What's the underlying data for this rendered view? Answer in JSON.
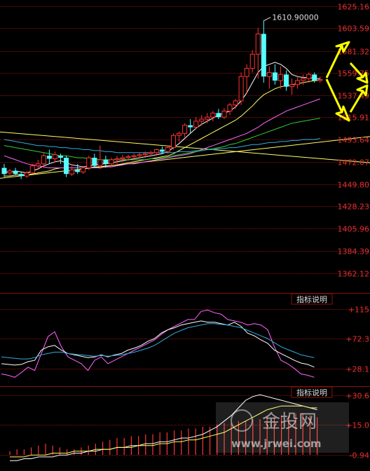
{
  "chart_data": [
    {
      "type": "candlestick",
      "price_axis": {
        "ticks": [
          "1625.16",
          "1603.59",
          "1581.32",
          "1559.75",
          "1537.49",
          "1515.91",
          "1493.64",
          "1472.07",
          "1449.80",
          "1428.23",
          "1405.96",
          "1384.39",
          "1362.12"
        ],
        "tick_values": [
          1625.16,
          1603.59,
          1581.32,
          1559.75,
          1537.49,
          1515.91,
          1493.64,
          1472.07,
          1449.8,
          1428.23,
          1405.96,
          1384.39,
          1362.12
        ],
        "ylim": [
          1345,
          1627
        ]
      },
      "annotation": {
        "label": "1610.90000",
        "value": 1610.9,
        "index": 46
      },
      "candles": [
        {
          "o": 1466,
          "h": 1470,
          "l": 1457,
          "c": 1460
        },
        {
          "o": 1461,
          "h": 1465,
          "l": 1458,
          "c": 1463
        },
        {
          "o": 1463,
          "h": 1466,
          "l": 1459,
          "c": 1460
        },
        {
          "o": 1460,
          "h": 1462,
          "l": 1455,
          "c": 1458
        },
        {
          "o": 1458,
          "h": 1463,
          "l": 1456,
          "c": 1461
        },
        {
          "o": 1461,
          "h": 1470,
          "l": 1460,
          "c": 1468
        },
        {
          "o": 1468,
          "h": 1474,
          "l": 1464,
          "c": 1470
        },
        {
          "o": 1470,
          "h": 1481,
          "l": 1466,
          "c": 1478
        },
        {
          "o": 1478,
          "h": 1484,
          "l": 1470,
          "c": 1475
        },
        {
          "o": 1475,
          "h": 1482,
          "l": 1471,
          "c": 1479
        },
        {
          "o": 1478,
          "h": 1480,
          "l": 1470,
          "c": 1476
        },
        {
          "o": 1476,
          "h": 1478,
          "l": 1457,
          "c": 1460
        },
        {
          "o": 1460,
          "h": 1468,
          "l": 1458,
          "c": 1464
        },
        {
          "o": 1464,
          "h": 1470,
          "l": 1460,
          "c": 1462
        },
        {
          "o": 1462,
          "h": 1468,
          "l": 1460,
          "c": 1466
        },
        {
          "o": 1466,
          "h": 1478,
          "l": 1464,
          "c": 1476
        },
        {
          "o": 1476,
          "h": 1480,
          "l": 1466,
          "c": 1468
        },
        {
          "o": 1468,
          "h": 1488,
          "l": 1465,
          "c": 1474
        },
        {
          "o": 1474,
          "h": 1478,
          "l": 1466,
          "c": 1470
        },
        {
          "o": 1470,
          "h": 1476,
          "l": 1468,
          "c": 1474
        },
        {
          "o": 1474,
          "h": 1478,
          "l": 1470,
          "c": 1475
        },
        {
          "o": 1475,
          "h": 1479,
          "l": 1472,
          "c": 1476
        },
        {
          "o": 1476,
          "h": 1479,
          "l": 1473,
          "c": 1477
        },
        {
          "o": 1477,
          "h": 1480,
          "l": 1474,
          "c": 1478
        },
        {
          "o": 1478,
          "h": 1481,
          "l": 1475,
          "c": 1479
        },
        {
          "o": 1479,
          "h": 1482,
          "l": 1476,
          "c": 1480
        },
        {
          "o": 1480,
          "h": 1483,
          "l": 1477,
          "c": 1481
        },
        {
          "o": 1481,
          "h": 1485,
          "l": 1478,
          "c": 1484
        },
        {
          "o": 1484,
          "h": 1487,
          "l": 1480,
          "c": 1482
        },
        {
          "o": 1482,
          "h": 1488,
          "l": 1480,
          "c": 1486
        },
        {
          "o": 1486,
          "h": 1500,
          "l": 1484,
          "c": 1498
        },
        {
          "o": 1498,
          "h": 1502,
          "l": 1492,
          "c": 1500
        },
        {
          "o": 1500,
          "h": 1510,
          "l": 1496,
          "c": 1508
        },
        {
          "o": 1508,
          "h": 1514,
          "l": 1500,
          "c": 1506
        },
        {
          "o": 1506,
          "h": 1516,
          "l": 1504,
          "c": 1512
        },
        {
          "o": 1512,
          "h": 1518,
          "l": 1508,
          "c": 1514
        },
        {
          "o": 1514,
          "h": 1520,
          "l": 1510,
          "c": 1516
        },
        {
          "o": 1516,
          "h": 1522,
          "l": 1512,
          "c": 1520
        },
        {
          "o": 1520,
          "h": 1524,
          "l": 1514,
          "c": 1516
        },
        {
          "o": 1516,
          "h": 1525,
          "l": 1514,
          "c": 1522
        },
        {
          "o": 1522,
          "h": 1530,
          "l": 1518,
          "c": 1528
        },
        {
          "o": 1528,
          "h": 1534,
          "l": 1524,
          "c": 1532
        },
        {
          "o": 1532,
          "h": 1560,
          "l": 1528,
          "c": 1556
        },
        {
          "o": 1556,
          "h": 1568,
          "l": 1540,
          "c": 1564
        },
        {
          "o": 1564,
          "h": 1582,
          "l": 1560,
          "c": 1578
        },
        {
          "o": 1578,
          "h": 1604,
          "l": 1554,
          "c": 1598
        },
        {
          "o": 1598,
          "h": 1611,
          "l": 1550,
          "c": 1556
        },
        {
          "o": 1556,
          "h": 1566,
          "l": 1544,
          "c": 1560
        },
        {
          "o": 1560,
          "h": 1568,
          "l": 1548,
          "c": 1552
        },
        {
          "o": 1552,
          "h": 1566,
          "l": 1544,
          "c": 1558
        },
        {
          "o": 1558,
          "h": 1562,
          "l": 1542,
          "c": 1546
        },
        {
          "o": 1546,
          "h": 1554,
          "l": 1538,
          "c": 1548
        },
        {
          "o": 1548,
          "h": 1556,
          "l": 1544,
          "c": 1552
        },
        {
          "o": 1552,
          "h": 1558,
          "l": 1548,
          "c": 1554
        },
        {
          "o": 1554,
          "h": 1560,
          "l": 1550,
          "c": 1558
        },
        {
          "o": 1558,
          "h": 1560,
          "l": 1550,
          "c": 1552
        },
        {
          "o": 1552,
          "h": 1556,
          "l": 1550,
          "c": 1553
        }
      ],
      "moving_averages": [
        {
          "color": "#ffffff",
          "values": [
            1462,
            1462,
            1463,
            1462,
            1461,
            1463,
            1465,
            1468,
            1470,
            1472,
            1473,
            1471,
            1469,
            1468,
            1467,
            1468,
            1469,
            1470,
            1470,
            1471,
            1472,
            1473,
            1474,
            1475,
            1476,
            1477,
            1478,
            1479,
            1480,
            1482,
            1486,
            1490,
            1495,
            1500,
            1505,
            1509,
            1512,
            1515,
            1518,
            1520,
            1522,
            1526,
            1532,
            1540,
            1550,
            1560,
            1566,
            1568,
            1570,
            1568,
            1564,
            1558,
            1556,
            1555,
            1555,
            1554,
            1554
          ]
        },
        {
          "color": "#ffff66",
          "values": [
            1458,
            1458,
            1459,
            1459,
            1459,
            1460,
            1461,
            1462,
            1463,
            1465,
            1466,
            1466,
            1466,
            1466,
            1466,
            1466,
            1467,
            1467,
            1468,
            1468,
            1469,
            1470,
            1471,
            1472,
            1473,
            1474,
            1475,
            1476,
            1477,
            1478,
            1480,
            1483,
            1486,
            1489,
            1492,
            1495,
            1498,
            1501,
            1504,
            1507,
            1510,
            1513,
            1517,
            1522,
            1527,
            1533,
            1538,
            1541,
            1544,
            1546,
            1547,
            1548,
            1549,
            1550,
            1551,
            1552,
            1552
          ]
        },
        {
          "color": "#ff66ff",
          "values": [
            1478,
            1476,
            1474,
            1472,
            1470,
            1469,
            1468,
            1467,
            1466,
            1466,
            1466,
            1466,
            1466,
            1466,
            1466,
            1466,
            1466,
            1466,
            1467,
            1467,
            1468,
            1469,
            1470,
            1470,
            1471,
            1472,
            1473,
            1474,
            1475,
            1476,
            1477,
            1478,
            1479,
            1480,
            1482,
            1484,
            1486,
            1488,
            1490,
            1492,
            1494,
            1496,
            1498,
            1500,
            1503,
            1506,
            1510,
            1513,
            1516,
            1519,
            1522,
            1524,
            1526,
            1528,
            1530,
            1532,
            1534
          ]
        },
        {
          "color": "#33cc33",
          "values": [
            1488,
            1487,
            1486,
            1485,
            1484,
            1483,
            1482,
            1481,
            1480,
            1479,
            1478,
            1478,
            1477,
            1476,
            1476,
            1475,
            1475,
            1474,
            1474,
            1474,
            1474,
            1474,
            1474,
            1474,
            1474,
            1474,
            1475,
            1475,
            1476,
            1477,
            1478,
            1479,
            1480,
            1481,
            1482,
            1483,
            1484,
            1485,
            1486,
            1487,
            1489,
            1490,
            1492,
            1494,
            1496,
            1498,
            1500,
            1502,
            1504,
            1506,
            1508,
            1510,
            1511,
            1512,
            1513,
            1514,
            1515
          ]
        },
        {
          "color": "#33aadd",
          "values": [
            1494,
            1493,
            1492,
            1491,
            1490,
            1489,
            1488,
            1488,
            1487,
            1487,
            1486,
            1486,
            1485,
            1485,
            1484,
            1484,
            1483,
            1483,
            1482,
            1482,
            1481,
            1481,
            1481,
            1481,
            1481,
            1481,
            1481,
            1481,
            1481,
            1481,
            1481,
            1482,
            1482,
            1482,
            1483,
            1483,
            1484,
            1484,
            1485,
            1485,
            1486,
            1486,
            1487,
            1488,
            1489,
            1489,
            1490,
            1491,
            1491,
            1492,
            1492,
            1493,
            1493,
            1494,
            1494,
            1494,
            1495
          ]
        }
      ],
      "trendlines": [
        {
          "color": "#ffff66",
          "from": {
            "index": -2,
            "value": 1502
          },
          "to": {
            "index": 65,
            "value": 1471
          }
        },
        {
          "color": "#ffff66",
          "from": {
            "index": -2,
            "value": 1455
          },
          "to": {
            "index": 65,
            "value": 1497
          }
        }
      ],
      "arrows_color": "#ffff00"
    },
    {
      "type": "line",
      "button_label": "指标说明",
      "axis_ticks": [
        "+115",
        "+72.3",
        "+28.1"
      ],
      "axis_tick_values": [
        115,
        72.3,
        28.1
      ],
      "ylim": [
        5,
        135
      ],
      "series": [
        {
          "color": "#ff66ff",
          "values": [
            20,
            18,
            15,
            22,
            30,
            25,
            50,
            75,
            82,
            60,
            45,
            40,
            35,
            25,
            40,
            45,
            35,
            40,
            45,
            50,
            55,
            60,
            65,
            70,
            78,
            85,
            90,
            95,
            100,
            100,
            112,
            114,
            110,
            108,
            100,
            98,
            96,
            92,
            94,
            92,
            85,
            60,
            40,
            35,
            28,
            20,
            18,
            15
          ]
        },
        {
          "color": "#ffffff",
          "values": [
            35,
            34,
            33,
            34,
            38,
            40,
            55,
            60,
            62,
            55,
            50,
            48,
            46,
            44,
            45,
            48,
            45,
            48,
            50,
            55,
            58,
            62,
            68,
            72,
            80,
            85,
            88,
            92,
            94,
            96,
            98,
            96,
            96,
            94,
            92,
            96,
            90,
            80,
            76,
            70,
            65,
            55,
            50,
            45,
            40,
            36,
            34,
            30
          ]
        },
        {
          "color": "#33aadd",
          "values": [
            45,
            44,
            43,
            42,
            42,
            44,
            48,
            50,
            52,
            52,
            50,
            49,
            48,
            47,
            46,
            47,
            46,
            47,
            48,
            50,
            52,
            55,
            58,
            62,
            68,
            74,
            80,
            84,
            88,
            90,
            92,
            94,
            94,
            93,
            92,
            90,
            88,
            84,
            80,
            76,
            72,
            66,
            60,
            56,
            52,
            48,
            46,
            44
          ]
        }
      ]
    },
    {
      "type": "bar",
      "button_label": "指标说明",
      "axis_ticks": [
        "+30.6",
        "+15.0",
        "-0.94"
      ],
      "axis_tick_values": [
        30.6,
        15.0,
        -0.94
      ],
      "ylim": [
        -8,
        34
      ],
      "bars": [
        1,
        2,
        2,
        3,
        4,
        5,
        4,
        3,
        2,
        2,
        3,
        4,
        5,
        6,
        7,
        8,
        8,
        9,
        9,
        10,
        10,
        11,
        11,
        12,
        12,
        13,
        13,
        14,
        14,
        15,
        16,
        16,
        17,
        17,
        18,
        18,
        19,
        19,
        20,
        20,
        21,
        21,
        20,
        19
      ],
      "series": [
        {
          "color": "#ffffff",
          "values": [
            -4,
            -4,
            -3,
            -3,
            -2,
            -2,
            -2,
            -1,
            -1,
            0,
            0,
            1,
            1,
            2,
            2,
            3,
            3,
            4,
            4,
            5,
            5,
            6,
            6,
            7,
            8,
            8,
            9,
            10,
            12,
            14,
            17,
            20,
            24,
            28,
            30,
            31,
            30,
            29,
            28,
            27,
            26,
            25,
            24,
            23
          ]
        },
        {
          "color": "#ffff66",
          "values": [
            -2,
            -2,
            -2,
            -1,
            -1,
            -1,
            0,
            0,
            0,
            1,
            1,
            1,
            2,
            2,
            2,
            3,
            3,
            3,
            4,
            4,
            4,
            5,
            5,
            6,
            6,
            7,
            7,
            8,
            9,
            10,
            11,
            13,
            15,
            17,
            19,
            21,
            23,
            24,
            25,
            25,
            25,
            25,
            24,
            24
          ]
        }
      ]
    }
  ],
  "watermark": {
    "brand": "金投网",
    "url": "www.jrwei.com"
  },
  "colors": {
    "grid": "#8a1010",
    "axis_text": "#e03030",
    "up_candle": "#ff3333",
    "down_candle": "#55ffff",
    "background": "#000000"
  }
}
